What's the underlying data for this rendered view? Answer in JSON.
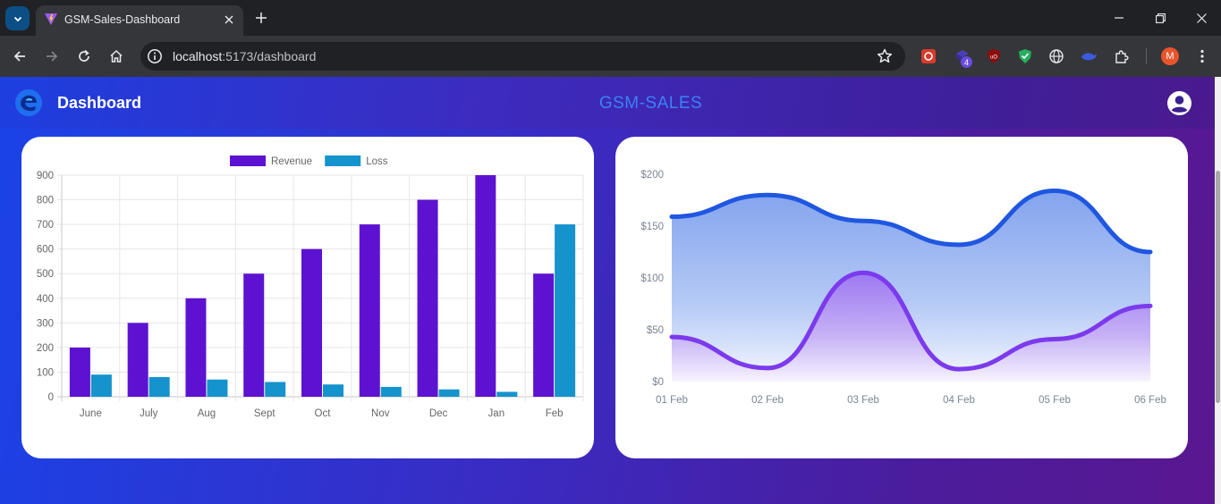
{
  "browser": {
    "tab_title": "GSM-Sales-Dashboard",
    "url_host": "localhost",
    "url_path": ":5173/dashboard",
    "extension_badge": "4",
    "profile_initial": "M"
  },
  "header": {
    "title": "Dashboard",
    "brand": "GSM-SALES"
  },
  "chart_data": [
    {
      "type": "bar",
      "categories": [
        "June",
        "July",
        "Aug",
        "Sept",
        "Oct",
        "Nov",
        "Dec",
        "Jan",
        "Feb"
      ],
      "series": [
        {
          "name": "Revenue",
          "color": "#5d12d2",
          "values": [
            200,
            300,
            400,
            500,
            600,
            700,
            800,
            900,
            500
          ]
        },
        {
          "name": "Loss",
          "color": "#1493cd",
          "values": [
            90,
            80,
            70,
            60,
            50,
            40,
            30,
            20,
            700
          ]
        }
      ],
      "ylim": [
        0,
        900
      ],
      "yticks": [
        0,
        100,
        200,
        300,
        400,
        500,
        600,
        700,
        800,
        900
      ],
      "legend": "top",
      "grid": true
    },
    {
      "type": "area",
      "x": [
        "01 Feb",
        "02 Feb",
        "03 Feb",
        "04 Feb",
        "05 Feb",
        "06 Feb"
      ],
      "series": [
        {
          "color": "#1f57e0",
          "values": [
            159,
            180,
            155,
            132,
            184,
            125
          ]
        },
        {
          "color": "#7c3aed",
          "values": [
            43,
            13,
            105,
            12,
            41,
            73
          ]
        }
      ],
      "ylim": [
        0,
        200
      ],
      "yticks": [
        0,
        50,
        100,
        150,
        200
      ],
      "ytick_labels": [
        "$0",
        "$50",
        "$100",
        "$150",
        "$200"
      ],
      "grid": false
    }
  ]
}
